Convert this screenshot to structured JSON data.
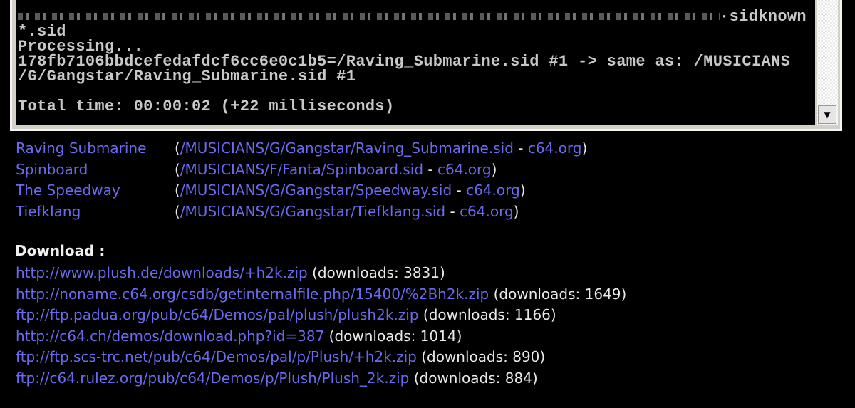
{
  "console": {
    "line1_tail": "sidknown",
    "lines": [
      "*.sid",
      "Processing...",
      "178fb7106bbdcefedafdcf6cc6e0c1b5=/Raving_Submarine.sid #1 -> same as: /MUSICIANS",
      "/G/Gangstar/Raving_Submarine.sid #1",
      "",
      "Total time: 00:00:02 (+22 milliseconds)"
    ]
  },
  "tunes": [
    {
      "name": "Raving Submarine",
      "path": "/MUSICIANS/G/Gangstar/Raving_Submarine.sid",
      "source": "c64.org"
    },
    {
      "name": "Spinboard",
      "path": "/MUSICIANS/F/Fanta/Spinboard.sid",
      "source": "c64.org"
    },
    {
      "name": "The Speedway",
      "path": "/MUSICIANS/G/Gangstar/Speedway.sid",
      "source": "c64.org"
    },
    {
      "name": "Tiefklang",
      "path": "/MUSICIANS/G/Gangstar/Tiefklang.sid",
      "source": "c64.org"
    }
  ],
  "download": {
    "title": "Download :",
    "links": [
      {
        "url": "http://www.plush.de/downloads/+h2k.zip",
        "count": "(downloads: 3831)"
      },
      {
        "url": "http://noname.c64.org/csdb/getinternalfile.php/15400/%2Bh2k.zip",
        "count": "(downloads: 1649)"
      },
      {
        "url": "ftp://ftp.padua.org/pub/c64/Demos/pal/plush/plush2k.zip",
        "count": "(downloads: 1166)"
      },
      {
        "url": "http://c64.ch/demos/download.php?id=387",
        "count": "(downloads: 1014)"
      },
      {
        "url": "ftp://ftp.scs-trc.net/pub/c64/Demos/pal/p/Plush/+h2k.zip",
        "count": "(downloads: 890)"
      },
      {
        "url": "ftp://c64.rulez.org/pub/c64/Demos/p/Plush/Plush_2k.zip",
        "count": "(downloads: 884)"
      }
    ]
  },
  "colors": {
    "link": "#6a6af0",
    "text": "#e8e8e8",
    "background": "#000000"
  }
}
